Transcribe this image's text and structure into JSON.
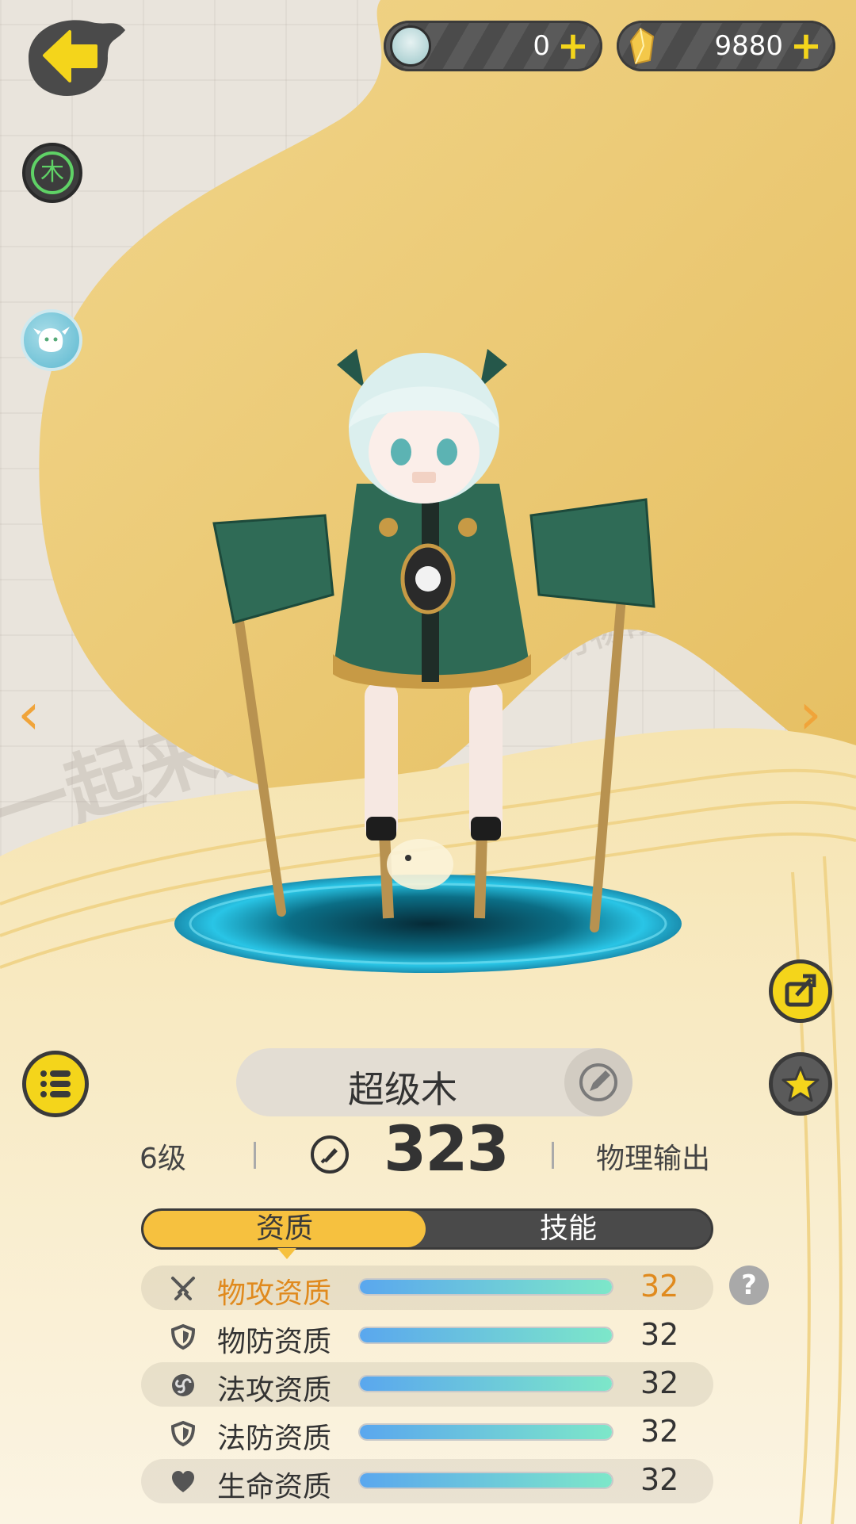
{
  "currencies": [
    {
      "icon": "spirit-avatar-icon",
      "value": "0"
    },
    {
      "icon": "gold-crystal-icon",
      "value": "9880"
    }
  ],
  "element": {
    "label": "木",
    "color": "#5fd266"
  },
  "background": {
    "watermarks": [
      "一起来捉妖",
      "万物有灵"
    ]
  },
  "pet": {
    "name": "超级木",
    "level": "6级",
    "power": "323",
    "role": "物理输出"
  },
  "tabs": [
    {
      "label": "资质",
      "active": true
    },
    {
      "label": "技能",
      "active": false
    }
  ],
  "attributes": [
    {
      "icon": "crossed-swords-icon",
      "label": "物攻资质",
      "value": "32",
      "fill": 1.0,
      "highlight": true
    },
    {
      "icon": "shield-icon",
      "label": "物防资质",
      "value": "32",
      "fill": 1.0,
      "highlight": false
    },
    {
      "icon": "swirl-icon",
      "label": "法攻资质",
      "value": "32",
      "fill": 1.0,
      "highlight": false
    },
    {
      "icon": "shield-icon",
      "label": "法防资质",
      "value": "32",
      "fill": 1.0,
      "highlight": false
    },
    {
      "icon": "heart-icon",
      "label": "生命资质",
      "value": "32",
      "fill": 1.0,
      "highlight": false
    }
  ],
  "colors": {
    "accent": "#f6c13f",
    "highlight": "#e08a1e",
    "button_yellow": "#f4d51b",
    "dark": "#4a4a4a"
  }
}
